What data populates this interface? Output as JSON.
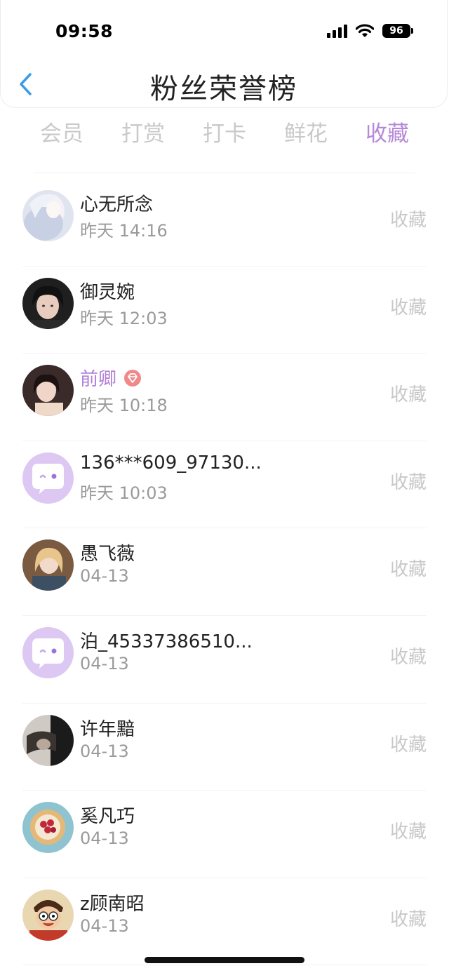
{
  "status_bar": {
    "time": "09:58",
    "battery": "96"
  },
  "header": {
    "title": "粉丝荣誉榜",
    "back_icon": "chevron-left-icon"
  },
  "tabs": [
    {
      "label": "会员",
      "active": false
    },
    {
      "label": "打赏",
      "active": false
    },
    {
      "label": "打卡",
      "active": false
    },
    {
      "label": "鲜花",
      "active": false
    },
    {
      "label": "收藏",
      "active": true
    }
  ],
  "colors": {
    "accent": "#b588d8",
    "muted": "#c8c8c8",
    "vip_badge": "#f08a8a"
  },
  "fans": [
    {
      "name": "心无所念",
      "time": "昨天 14:16",
      "action": "收藏",
      "avatar": "photo-avatar"
    },
    {
      "name": "御灵婉",
      "time": "昨天 12:03",
      "action": "收藏",
      "avatar": "photo-avatar"
    },
    {
      "name": "前卿",
      "time": "昨天 10:18",
      "action": "收藏",
      "avatar": "photo-avatar",
      "badge": "diamond-badge-icon"
    },
    {
      "name": "136***609_97130...",
      "time": "昨天 10:03",
      "action": "收藏",
      "avatar": "default-chat-avatar"
    },
    {
      "name": "愚飞薇",
      "time": "04-13",
      "action": "收藏",
      "avatar": "photo-avatar"
    },
    {
      "name": "泊_45337386510...",
      "time": "04-13",
      "action": "收藏",
      "avatar": "default-chat-avatar"
    },
    {
      "name": "许年黯",
      "time": "04-13",
      "action": "收藏",
      "avatar": "photo-avatar"
    },
    {
      "name": "奚凡巧",
      "time": "04-13",
      "action": "收藏",
      "avatar": "photo-avatar"
    },
    {
      "name": "z顾南昭",
      "time": "04-13",
      "action": "收藏",
      "avatar": "cartoon-avatar"
    }
  ]
}
